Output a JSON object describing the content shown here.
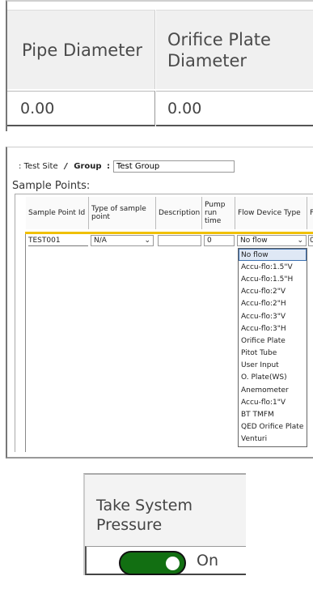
{
  "pipe_table": {
    "headers": [
      "Pipe Diameter",
      "Orifice Plate Diameter"
    ],
    "row": [
      "0.00",
      "0.00"
    ]
  },
  "sample_points": {
    "breadcrumb": {
      "site_prefix": ":",
      "site": "Test Site",
      "separator": "/",
      "group_label": "Group",
      "group_colon": ":",
      "group_value": "Test Group"
    },
    "title": "Sample Points:",
    "columns": [
      "Sample Point Id",
      "Type of sample point",
      "Description",
      "Pump run time",
      "Flow Device Type",
      "F"
    ],
    "row": {
      "id": "TEST001",
      "type": "N/A",
      "description": "",
      "pump_run_time": "0",
      "flow_device": "No flow",
      "extra": "0"
    },
    "flow_device_options": [
      "No flow",
      "Accu-flo:1.5\"V",
      "Accu-flo:1.5\"H",
      "Accu-flo:2\"V",
      "Accu-flo:2\"H",
      "Accu-flo:3\"V",
      "Accu-flo:3\"H",
      "Orifice Plate",
      "Pitot Tube",
      "User Input",
      "O. Plate(WS)",
      "Anemometer",
      "Accu-flo:1\"V",
      "BT TMFM",
      "QED Orifice Plate",
      "Venturi"
    ],
    "selected_option": "No flow"
  },
  "system_pressure": {
    "title": "Take System Pressure",
    "toggle_state": "On",
    "toggle_on": true,
    "toggle_color": "#126f12"
  }
}
